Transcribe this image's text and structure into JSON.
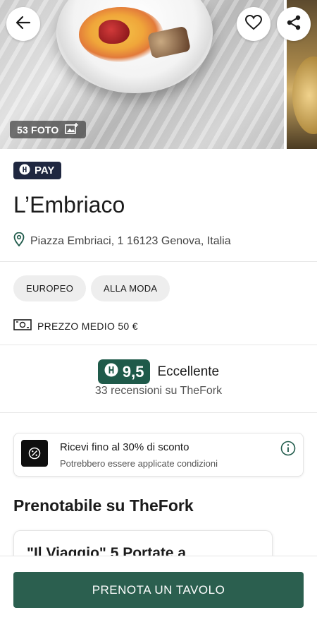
{
  "hero": {
    "photo_count": "53 FOTO"
  },
  "pay_badge": {
    "label": "PAY"
  },
  "restaurant": {
    "name": "L’Embriaco",
    "address": "Piazza Embriaci, 1 16123 Genova, Italia"
  },
  "tags": [
    "EUROPEO",
    "ALLA MODA"
  ],
  "price": {
    "label": "PREZZO MEDIO 50 €"
  },
  "rating": {
    "score": "9,5",
    "word": "Eccellente",
    "reviews": "33 recensioni su TheFork"
  },
  "promo": {
    "title": "Ricevi fino al 30% di sconto",
    "subtitle": "Potrebbero essere applicate condizioni"
  },
  "booking_section": {
    "title": "Prenotabile su TheFork",
    "card_title": "\"Il Viaggio\" 5 Portate a"
  },
  "cta": {
    "label": "PRENOTA UN TAVOLO"
  },
  "colors": {
    "primary_green": "#2b5f4f",
    "rating_green": "#1f5a4a",
    "pay_navy": "#1f2740"
  },
  "icons": [
    "back-arrow-icon",
    "heart-icon",
    "share-icon",
    "photo-add-icon",
    "fork-icon",
    "map-pin-icon",
    "banknote-icon",
    "percent-icon",
    "info-icon"
  ]
}
